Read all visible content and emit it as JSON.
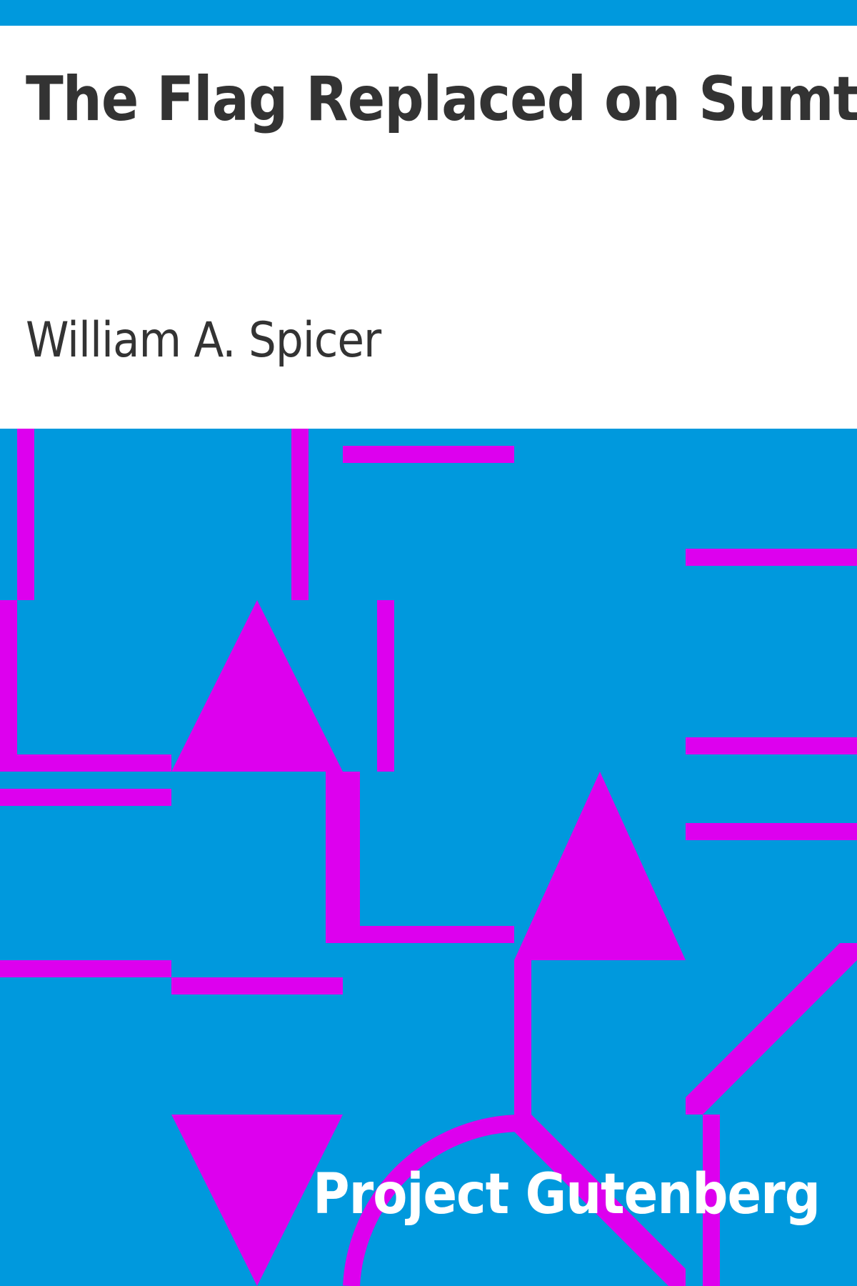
{
  "book": {
    "title": "The Flag Replaced on Sumter",
    "author": "William A. Spicer",
    "publisher": "Project Gutenberg"
  },
  "colors": {
    "background_blue": "#0099dd",
    "pattern_magenta": "#dd00ee",
    "text_dark": "#333333",
    "text_light": "#ffffff",
    "header_white": "#ffffff"
  },
  "decoration": {
    "pattern": "geometric magenta bars, triangles and arc on blue"
  }
}
